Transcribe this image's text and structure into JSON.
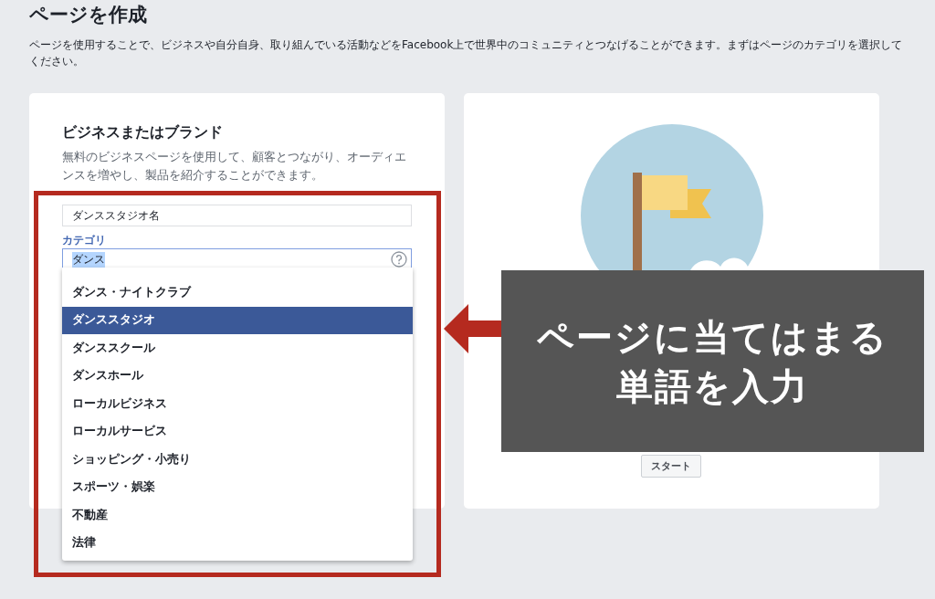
{
  "page": {
    "title": "ページを作成",
    "description": "ページを使用することで、ビジネスや自分自身、取り組んでいる活動などをFacebook上で世界中のコミュニティとつなげることができます。まずはページのカテゴリを選択してください。"
  },
  "cards": [
    {
      "kind": "form",
      "title": "ビジネスまたはブランド",
      "description": "無料のビジネスページを使用して、顧客とつながり、オーディエンスを増やし、製品を紹介することができます。",
      "name_field": {
        "value": "ダンススタジオ名"
      },
      "category_field": {
        "label": "カテゴリ",
        "value": "ダンス",
        "text_selected": true
      },
      "dropdown": [
        {
          "label": "ダンス・ナイトクラブ",
          "selected": false
        },
        {
          "label": "ダンススタジオ",
          "selected": true
        },
        {
          "label": "ダンススクール",
          "selected": false
        },
        {
          "label": "ダンスホール",
          "selected": false
        },
        {
          "label": "ローカルビジネス",
          "selected": false
        },
        {
          "label": "ローカルサービス",
          "selected": false
        },
        {
          "label": "ショッピング・小売り",
          "selected": false
        },
        {
          "label": "スポーツ・娯楽",
          "selected": false
        },
        {
          "label": "不動産",
          "selected": false
        },
        {
          "label": "法律",
          "selected": false
        }
      ]
    },
    {
      "kind": "illustration",
      "button": "スタート"
    }
  ],
  "annotation": {
    "lines": [
      "ページに当てはまる",
      "単語を入力"
    ]
  }
}
